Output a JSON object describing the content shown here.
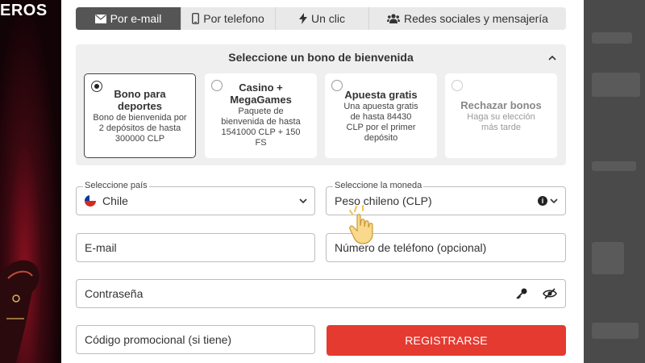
{
  "left_panel": {
    "title": "EROS"
  },
  "tabs": [
    {
      "label": "Por e-mail",
      "icon": "envelope-icon",
      "active": true
    },
    {
      "label": "Por telefono",
      "icon": "phone-icon",
      "active": false
    },
    {
      "label": "Un clic",
      "icon": "lightning-icon",
      "active": false
    },
    {
      "label": "Redes sociales y mensajería",
      "icon": "users-icon",
      "active": false
    }
  ],
  "bonus": {
    "title": "Seleccione un bono de bienvenida",
    "cards": [
      {
        "title": "Bono para deportes",
        "desc": "Bono de bienvenida por 2 depósitos de hasta 300000 CLP",
        "selected": true
      },
      {
        "title": "Casino + MegaGames",
        "desc": "Paquete de bienvenida de hasta 1541000 CLP + 150 FS",
        "selected": false
      },
      {
        "title": "Apuesta gratis",
        "desc": "Una apuesta gratis de hasta 84430 CLP por el primer depósito",
        "selected": false
      },
      {
        "title": "Rechazar bonos",
        "desc": "Haga su elección más tarde",
        "selected": false
      }
    ]
  },
  "form": {
    "country_label": "Seleccione país",
    "country_value": "Chile",
    "currency_label": "Seleccione la moneda",
    "currency_value": "Peso chileno (CLP)",
    "email_placeholder": "E-mail",
    "phone_placeholder": "Número de teléfono (opcional)",
    "password_placeholder": "Contraseña",
    "promo_placeholder": "Código promocional (si tiene)",
    "register_label": "REGISTRARSE"
  },
  "colors": {
    "accent": "#e53a30",
    "active_tab": "#555555"
  }
}
